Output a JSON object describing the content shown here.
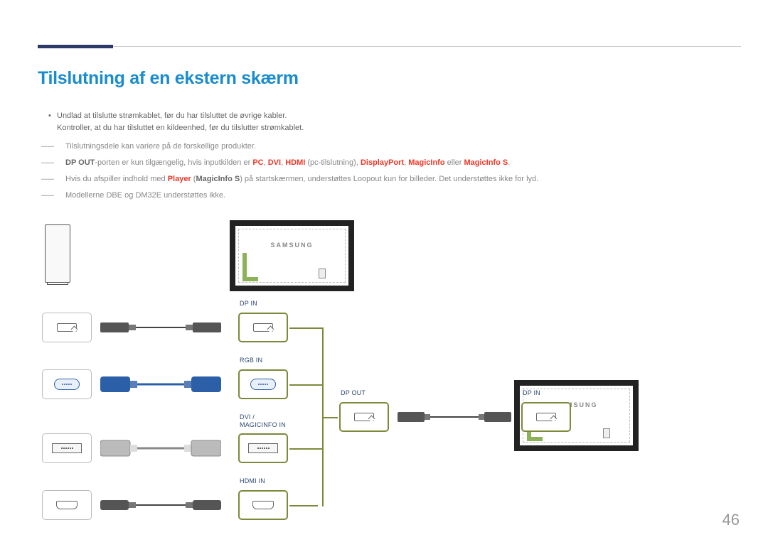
{
  "title": "Tilslutning af en ekstern skærm",
  "bullets": {
    "line1": "Undlad at tilslutte strømkablet, før du har tilsluttet de øvrige kabler.",
    "line2": "Kontroller, at du har tilsluttet en kildeenhed, før du tilslutter strømkablet."
  },
  "notes": {
    "n1": "Tilslutningsdele kan variere på de forskellige produkter.",
    "n2_pre": "DP OUT",
    "n2_mid": "-porten er kun tilgængelig, hvis inputkilden er ",
    "n2_pc": "PC",
    "n2_dvi": "DVI",
    "n2_hdmi": "HDMI",
    "n2_pctil": " (pc-tilslutning), ",
    "n2_dp": "DisplayPort",
    "n2_mi": "MagicInfo",
    "n2_eller": " eller ",
    "n2_mis": "MagicInfo S",
    "n2_end": ".",
    "n3_pre": "Hvis du afspiller indhold med ",
    "n3_player": "Player",
    "n3_paren": " (",
    "n3_mis": "MagicInfo S",
    "n3_rest": ") på startskærmen, understøttes Loopout kun for billeder. Det understøttes ikke for lyd.",
    "n4": "Modellerne DBE og DM32E understøttes ikke."
  },
  "labels": {
    "dp_in": "DP IN",
    "rgb_in": "RGB IN",
    "dvi_magicinfo_in_1": "DVI /",
    "dvi_magicinfo_in_2": "MAGICINFO IN",
    "hdmi_in": "HDMI IN",
    "dp_out": "DP OUT",
    "dp_in_right": "DP IN"
  },
  "monitor_brand": "SAMSUNG",
  "page_number": "46"
}
